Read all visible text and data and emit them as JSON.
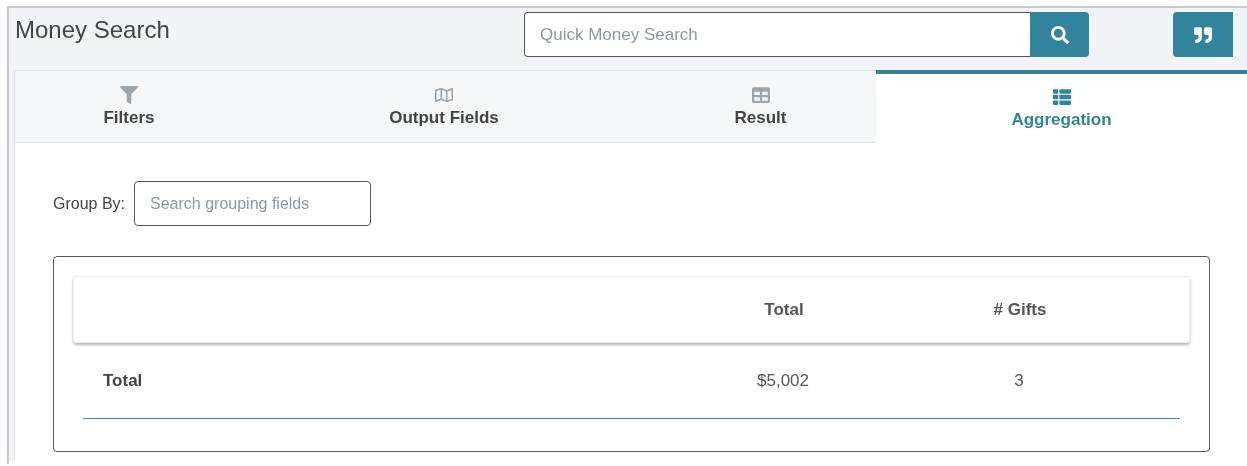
{
  "title": "Money Search",
  "quick_search": {
    "placeholder": "Quick Money Search"
  },
  "tabs": [
    {
      "label": "Filters",
      "selected": false
    },
    {
      "label": "Output Fields",
      "selected": false
    },
    {
      "label": "Result",
      "selected": false
    },
    {
      "label": "Aggregation",
      "selected": true
    }
  ],
  "group_by": {
    "label": "Group By:",
    "placeholder": "Search grouping fields"
  },
  "table": {
    "columns": [
      "Total",
      "# Gifts"
    ],
    "rows": [
      {
        "label": "Total",
        "cells": [
          "$5,002",
          "3"
        ]
      }
    ]
  }
}
